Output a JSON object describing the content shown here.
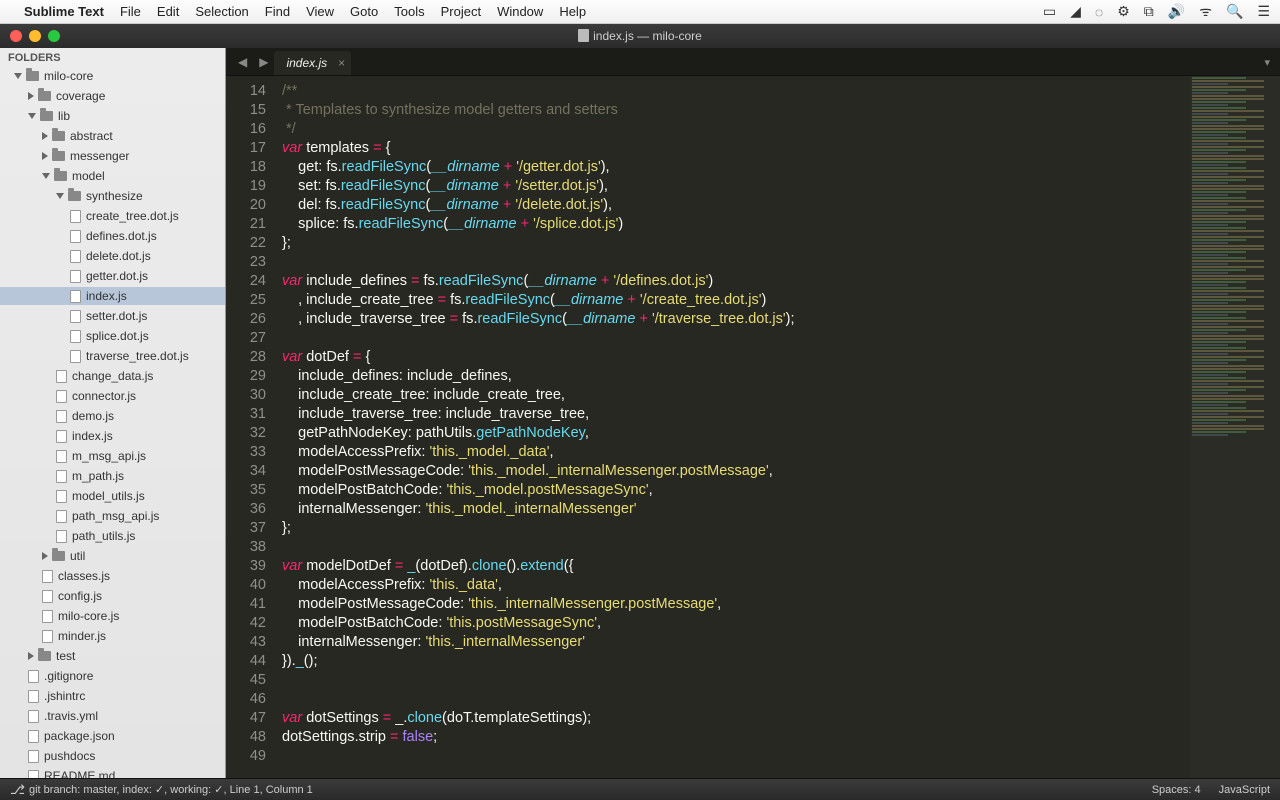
{
  "menubar": {
    "app": "Sublime Text",
    "items": [
      "File",
      "Edit",
      "Selection",
      "Find",
      "View",
      "Goto",
      "Tools",
      "Project",
      "Window",
      "Help"
    ]
  },
  "window_title": "index.js — milo-core",
  "sidebar": {
    "header": "FOLDERS",
    "tree": [
      {
        "depth": 0,
        "type": "folder",
        "open": true,
        "label": "milo-core"
      },
      {
        "depth": 1,
        "type": "folder",
        "open": false,
        "label": "coverage"
      },
      {
        "depth": 1,
        "type": "folder",
        "open": true,
        "label": "lib"
      },
      {
        "depth": 2,
        "type": "folder",
        "open": false,
        "label": "abstract"
      },
      {
        "depth": 2,
        "type": "folder",
        "open": false,
        "label": "messenger"
      },
      {
        "depth": 2,
        "type": "folder",
        "open": true,
        "label": "model"
      },
      {
        "depth": 3,
        "type": "folder",
        "open": true,
        "label": "synthesize"
      },
      {
        "depth": 4,
        "type": "file",
        "label": "create_tree.dot.js"
      },
      {
        "depth": 4,
        "type": "file",
        "label": "defines.dot.js"
      },
      {
        "depth": 4,
        "type": "file",
        "label": "delete.dot.js"
      },
      {
        "depth": 4,
        "type": "file",
        "label": "getter.dot.js"
      },
      {
        "depth": 4,
        "type": "file",
        "label": "index.js",
        "selected": true
      },
      {
        "depth": 4,
        "type": "file",
        "label": "setter.dot.js"
      },
      {
        "depth": 4,
        "type": "file",
        "label": "splice.dot.js"
      },
      {
        "depth": 4,
        "type": "file",
        "label": "traverse_tree.dot.js"
      },
      {
        "depth": 3,
        "type": "file",
        "label": "change_data.js"
      },
      {
        "depth": 3,
        "type": "file",
        "label": "connector.js"
      },
      {
        "depth": 3,
        "type": "file",
        "label": "demo.js"
      },
      {
        "depth": 3,
        "type": "file",
        "label": "index.js"
      },
      {
        "depth": 3,
        "type": "file",
        "label": "m_msg_api.js"
      },
      {
        "depth": 3,
        "type": "file",
        "label": "m_path.js"
      },
      {
        "depth": 3,
        "type": "file",
        "label": "model_utils.js"
      },
      {
        "depth": 3,
        "type": "file",
        "label": "path_msg_api.js"
      },
      {
        "depth": 3,
        "type": "file",
        "label": "path_utils.js"
      },
      {
        "depth": 2,
        "type": "folder",
        "open": false,
        "label": "util"
      },
      {
        "depth": 2,
        "type": "file",
        "label": "classes.js"
      },
      {
        "depth": 2,
        "type": "file",
        "label": "config.js"
      },
      {
        "depth": 2,
        "type": "file",
        "label": "milo-core.js"
      },
      {
        "depth": 2,
        "type": "file",
        "label": "minder.js"
      },
      {
        "depth": 1,
        "type": "folder",
        "open": false,
        "label": "test"
      },
      {
        "depth": 1,
        "type": "file",
        "label": ".gitignore"
      },
      {
        "depth": 1,
        "type": "file",
        "label": ".jshintrc"
      },
      {
        "depth": 1,
        "type": "file",
        "label": ".travis.yml"
      },
      {
        "depth": 1,
        "type": "file",
        "label": "package.json"
      },
      {
        "depth": 1,
        "type": "file",
        "label": "pushdocs"
      },
      {
        "depth": 1,
        "type": "file",
        "label": "README.md"
      }
    ]
  },
  "tab": {
    "label": "index.js"
  },
  "code": {
    "first_line": 14,
    "lines": [
      {
        "n": 14,
        "html": "<span class='cm'>/**</span>"
      },
      {
        "n": 15,
        "html": "<span class='cm'> * Templates to synthesize model getters and setters</span>"
      },
      {
        "n": 16,
        "html": "<span class='cm'> */</span>"
      },
      {
        "n": 17,
        "html": "<span class='kw'>var</span> <span class='nm'>templates</span> <span class='op'>=</span> {"
      },
      {
        "n": 18,
        "html": "    <span class='prop'>get</span>: <span class='nm'>fs</span>.<span class='fn'>readFileSync</span>(<span class='dirn'>__dirname</span> <span class='op'>+</span> <span class='str'>'/getter.dot.js'</span>),"
      },
      {
        "n": 19,
        "html": "    <span class='prop'>set</span>: <span class='nm'>fs</span>.<span class='fn'>readFileSync</span>(<span class='dirn'>__dirname</span> <span class='op'>+</span> <span class='str'>'/setter.dot.js'</span>),"
      },
      {
        "n": 20,
        "html": "    <span class='prop'>del</span>: <span class='nm'>fs</span>.<span class='fn'>readFileSync</span>(<span class='dirn'>__dirname</span> <span class='op'>+</span> <span class='str'>'/delete.dot.js'</span>),"
      },
      {
        "n": 21,
        "html": "    <span class='prop'>splice</span>: <span class='nm'>fs</span>.<span class='fn'>readFileSync</span>(<span class='dirn'>__dirname</span> <span class='op'>+</span> <span class='str'>'/splice.dot.js'</span>)"
      },
      {
        "n": 22,
        "html": "};"
      },
      {
        "n": 23,
        "html": ""
      },
      {
        "n": 24,
        "html": "<span class='kw'>var</span> <span class='nm'>include_defines</span> <span class='op'>=</span> <span class='nm'>fs</span>.<span class='fn'>readFileSync</span>(<span class='dirn'>__dirname</span> <span class='op'>+</span> <span class='str'>'/defines.dot.js'</span>)"
      },
      {
        "n": 25,
        "html": "    , <span class='nm'>include_create_tree</span> <span class='op'>=</span> <span class='nm'>fs</span>.<span class='fn'>readFileSync</span>(<span class='dirn'>__dirname</span> <span class='op'>+</span> <span class='str'>'/create_tree.dot.js'</span>)"
      },
      {
        "n": 26,
        "html": "    , <span class='nm'>include_traverse_tree</span> <span class='op'>=</span> <span class='nm'>fs</span>.<span class='fn'>readFileSync</span>(<span class='dirn'>__dirname</span> <span class='op'>+</span> <span class='str'>'/traverse_tree.dot.js'</span>);"
      },
      {
        "n": 27,
        "html": ""
      },
      {
        "n": 28,
        "html": "<span class='kw'>var</span> <span class='nm'>dotDef</span> <span class='op'>=</span> {"
      },
      {
        "n": 29,
        "html": "    <span class='prop'>include_defines</span>: include_defines,"
      },
      {
        "n": 30,
        "html": "    <span class='prop'>include_create_tree</span>: include_create_tree,"
      },
      {
        "n": 31,
        "html": "    <span class='prop'>include_traverse_tree</span>: include_traverse_tree,"
      },
      {
        "n": 32,
        "html": "    <span class='prop'>getPathNodeKey</span>: pathUtils.<span class='fn'>getPathNodeKey</span>,"
      },
      {
        "n": 33,
        "html": "    <span class='prop'>modelAccessPrefix</span>: <span class='str'>'this._model._data'</span>,"
      },
      {
        "n": 34,
        "html": "    <span class='prop'>modelPostMessageCode</span>: <span class='str'>'this._model._internalMessenger.postMessage'</span>,"
      },
      {
        "n": 35,
        "html": "    <span class='prop'>modelPostBatchCode</span>: <span class='str'>'this._model.postMessageSync'</span>,"
      },
      {
        "n": 36,
        "html": "    <span class='prop'>internalMessenger</span>: <span class='str'>'this._model._internalMessenger'</span>"
      },
      {
        "n": 37,
        "html": "};"
      },
      {
        "n": 38,
        "html": ""
      },
      {
        "n": 39,
        "html": "<span class='kw'>var</span> <span class='nm'>modelDotDef</span> <span class='op'>=</span> <span class='fn'>_</span>(dotDef).<span class='fn'>clone</span>().<span class='fn'>extend</span>({"
      },
      {
        "n": 40,
        "html": "    <span class='prop'>modelAccessPrefix</span>: <span class='str'>'this._data'</span>,"
      },
      {
        "n": 41,
        "html": "    <span class='prop'>modelPostMessageCode</span>: <span class='str'>'this._internalMessenger.postMessage'</span>,"
      },
      {
        "n": 42,
        "html": "    <span class='prop'>modelPostBatchCode</span>: <span class='str'>'this.postMessageSync'</span>,"
      },
      {
        "n": 43,
        "html": "    <span class='prop'>internalMessenger</span>: <span class='str'>'this._internalMessenger'</span>"
      },
      {
        "n": 44,
        "html": "}).<span class='fn'>_</span>();"
      },
      {
        "n": 45,
        "html": ""
      },
      {
        "n": 46,
        "html": ""
      },
      {
        "n": 47,
        "html": "<span class='kw'>var</span> <span class='nm'>dotSettings</span> <span class='op'>=</span> _.<span class='fn'>clone</span>(doT.<span class='nm'>templateSettings</span>);"
      },
      {
        "n": 48,
        "html": "<span class='nm'>dotSettings</span>.<span class='nm'>strip</span> <span class='op'>=</span> <span class='bool'>false</span>;"
      },
      {
        "n": 49,
        "html": ""
      }
    ]
  },
  "statusbar": {
    "left": "git branch: master, index: ✓, working: ✓, Line 1, Column 1",
    "spaces": "Spaces: 4",
    "lang": "JavaScript"
  }
}
